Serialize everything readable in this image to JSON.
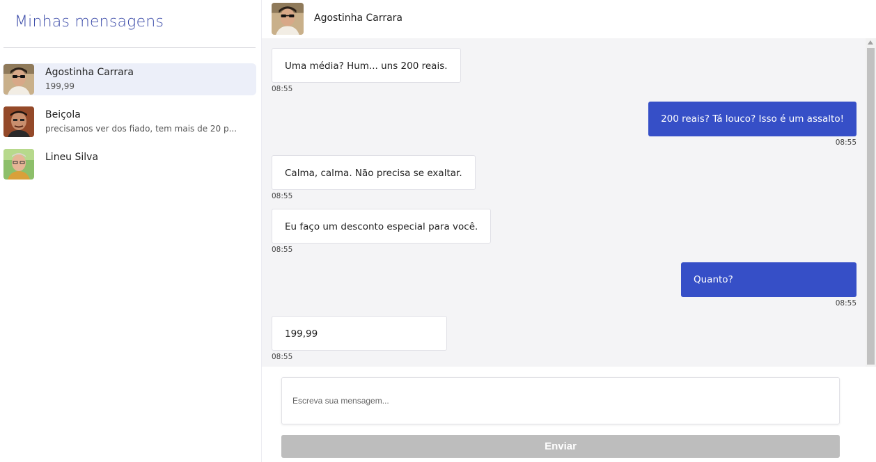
{
  "sidebar": {
    "title": "Minhas mensagens",
    "contacts": [
      {
        "name": "Agostinha Carrara",
        "preview": "199,99",
        "active": true
      },
      {
        "name": "Beiçola",
        "preview": "precisamos ver dos fiado, tem mais de 20 p..."
      },
      {
        "name": "Lineu Silva",
        "preview": ""
      }
    ]
  },
  "chat": {
    "contact_name": "Agostinha Carrara",
    "messages": [
      {
        "direction": "in",
        "text": "Uma média? Hum... uns 200 reais.",
        "time": "08:55"
      },
      {
        "direction": "out",
        "text": "200 reais? Tá louco? Isso é um assalto!",
        "time": "08:55"
      },
      {
        "direction": "in",
        "text": "Calma, calma. Não precisa se exaltar.",
        "time": "08:55"
      },
      {
        "direction": "in",
        "text": "Eu faço um desconto especial para você.",
        "time": "08:55"
      },
      {
        "direction": "out",
        "text": "Quanto?",
        "time": "08:55"
      },
      {
        "direction": "in",
        "text": "199,99",
        "time": "08:55"
      }
    ]
  },
  "composer": {
    "placeholder": "Escreva sua mensagem...",
    "value": "",
    "send_label": "Enviar"
  },
  "colors": {
    "accent": "#364fc7",
    "title": "#3a4aa8",
    "active_contact": "#eceff9",
    "messages_bg": "#f4f4f6",
    "send_disabled": "#bdbdbd"
  },
  "icons": [
    "avatar-agostinha",
    "avatar-beicola",
    "avatar-lineu",
    "scroll-up-arrow-icon"
  ]
}
